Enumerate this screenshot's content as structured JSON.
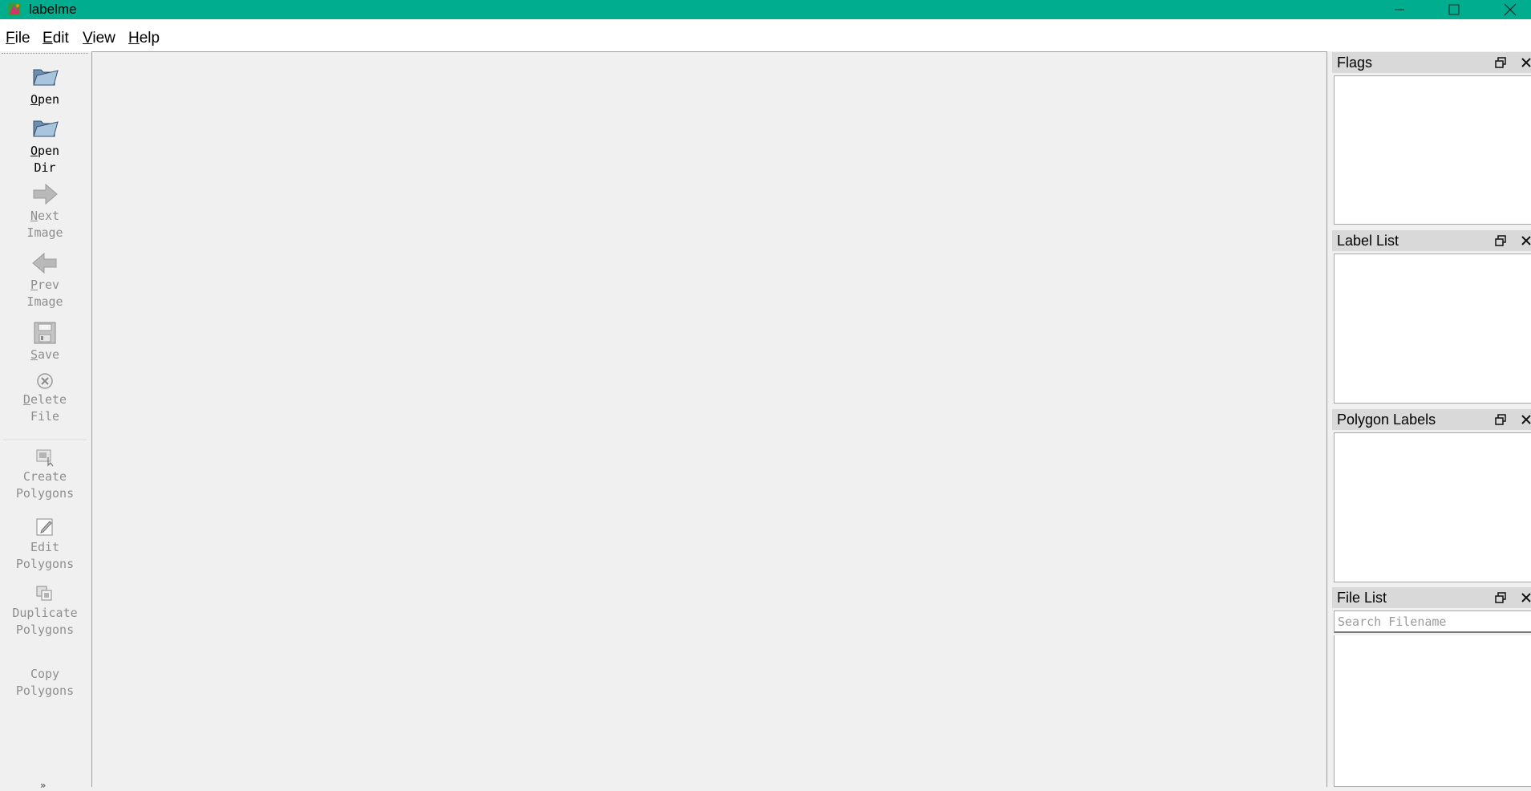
{
  "window": {
    "title": "labelme",
    "accent": "#00ad8f"
  },
  "menu": [
    {
      "mnemonic": "F",
      "rest": "ile"
    },
    {
      "mnemonic": "E",
      "rest": "dit"
    },
    {
      "mnemonic": "V",
      "rest": "iew"
    },
    {
      "mnemonic": "H",
      "rest": "elp"
    }
  ],
  "toolbar": {
    "open": {
      "mnemonic": "O",
      "rest": "pen",
      "icon": "folder-open-icon",
      "enabled": true
    },
    "open_dir": {
      "mnemonic": "O",
      "rest": "pen",
      "line2": "Dir",
      "icon": "folder-open-icon",
      "enabled": true
    },
    "next_image": {
      "mnemonic": "N",
      "rest": "ext",
      "line2": "Image",
      "icon": "arrow-right-icon",
      "enabled": false
    },
    "prev_image": {
      "mnemonic": "P",
      "rest": "rev",
      "line2": "Image",
      "icon": "arrow-left-icon",
      "enabled": false
    },
    "save": {
      "mnemonic": "S",
      "rest": "ave",
      "icon": "floppy-disk-icon",
      "enabled": false
    },
    "delete_file": {
      "mnemonic": "D",
      "rest": "elete",
      "line2": "File",
      "icon": "cancel-circle-icon",
      "enabled": false
    },
    "create_polygons": {
      "line1": "Create",
      "line2": "Polygons",
      "icon": "create-polygon-icon",
      "enabled": false
    },
    "edit_polygons": {
      "line1": "Edit",
      "line2": "Polygons",
      "icon": "edit-icon",
      "enabled": false
    },
    "duplicate_polygons": {
      "line1": "Duplicate",
      "line2": "Polygons",
      "icon": "duplicate-icon",
      "enabled": false
    },
    "copy_polygons": {
      "line1": "Copy",
      "line2": "Polygons",
      "enabled": false
    },
    "more": "»"
  },
  "docks": {
    "flags": {
      "title": "Flags"
    },
    "label_list": {
      "title": "Label List"
    },
    "polygon_labels": {
      "title": "Polygon Labels"
    },
    "file_list": {
      "title": "File List",
      "search_placeholder": "Search Filename",
      "search_value": ""
    }
  }
}
